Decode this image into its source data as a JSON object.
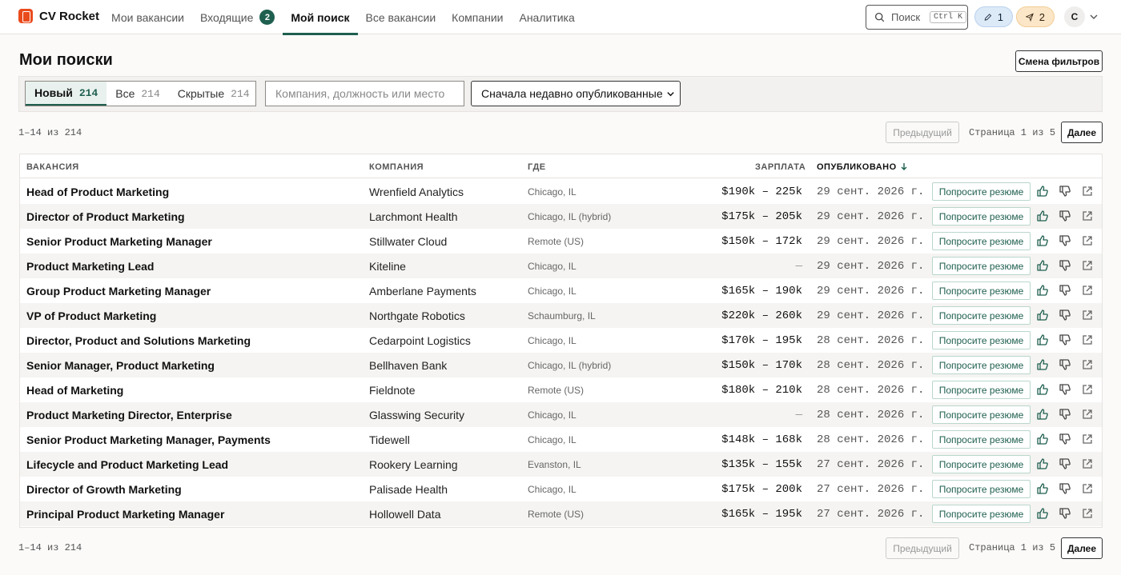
{
  "brand": {
    "name": "CV Rocket"
  },
  "nav": [
    {
      "label": "Мои вакансии"
    },
    {
      "label": "Входящие",
      "badge": "2"
    },
    {
      "label": "Мой поиск",
      "active": true
    },
    {
      "label": "Все вакансии"
    },
    {
      "label": "Компании"
    },
    {
      "label": "Аналитика"
    }
  ],
  "header": {
    "search_label": "Поиск",
    "search_shortcut": "Ctrl K",
    "edits_count": "1",
    "sent_count": "2",
    "avatar_initial": "C"
  },
  "page": {
    "title": "Мои поиски",
    "change_filters_label": "Смена фильтров"
  },
  "filters": {
    "tabs": [
      {
        "label": "Новый",
        "count": "214",
        "active": true
      },
      {
        "label": "Все",
        "count": "214"
      },
      {
        "label": "Скрытые",
        "count": "214"
      }
    ],
    "search_placeholder": "Компания, должность или место",
    "sort_value": "Сначала недавно опубликованные"
  },
  "pagination": {
    "range_label": "1–14 из 214",
    "prev_label": "Предыдущий",
    "page_label": "Страница 1 из 5",
    "next_label": "Далее"
  },
  "table": {
    "columns": {
      "title": "ВАКАНСИЯ",
      "company": "КОМПАНИЯ",
      "location": "ГДЕ",
      "salary": "ЗАРПЛАТА",
      "published": "ОПУБЛИКОВАНО"
    },
    "resume_label": "Попросите резюме",
    "rows": [
      {
        "title": "Head of Product Marketing",
        "company": "Wrenfield Analytics",
        "location": "Chicago, IL",
        "salary": "$190k – 225k",
        "date": "29 сент. 2026 г."
      },
      {
        "title": "Director of Product Marketing",
        "company": "Larchmont Health",
        "location": "Chicago, IL (hybrid)",
        "salary": "$175k – 205k",
        "date": "29 сент. 2026 г."
      },
      {
        "title": "Senior Product Marketing Manager",
        "company": "Stillwater Cloud",
        "location": "Remote (US)",
        "salary": "$150k – 172k",
        "date": "29 сент. 2026 г."
      },
      {
        "title": "Product Marketing Lead",
        "company": "Kiteline",
        "location": "Chicago, IL",
        "salary": "—",
        "date": "29 сент. 2026 г."
      },
      {
        "title": "Group Product Marketing Manager",
        "company": "Amberlane Payments",
        "location": "Chicago, IL",
        "salary": "$165k – 190k",
        "date": "29 сент. 2026 г."
      },
      {
        "title": "VP of Product Marketing",
        "company": "Northgate Robotics",
        "location": "Schaumburg, IL",
        "salary": "$220k – 260k",
        "date": "29 сент. 2026 г."
      },
      {
        "title": "Director, Product and Solutions Marketing",
        "company": "Cedarpoint Logistics",
        "location": "Chicago, IL",
        "salary": "$170k – 195k",
        "date": "28 сент. 2026 г."
      },
      {
        "title": "Senior Manager, Product Marketing",
        "company": "Bellhaven Bank",
        "location": "Chicago, IL (hybrid)",
        "salary": "$150k – 170k",
        "date": "28 сент. 2026 г."
      },
      {
        "title": "Head of Marketing",
        "company": "Fieldnote",
        "location": "Remote (US)",
        "salary": "$180k – 210k",
        "date": "28 сент. 2026 г."
      },
      {
        "title": "Product Marketing Director, Enterprise",
        "company": "Glasswing Security",
        "location": "Chicago, IL",
        "salary": "—",
        "date": "28 сент. 2026 г."
      },
      {
        "title": "Senior Product Marketing Manager, Payments",
        "company": "Tidewell",
        "location": "Chicago, IL",
        "salary": "$148k – 168k",
        "date": "28 сент. 2026 г."
      },
      {
        "title": "Lifecycle and Product Marketing Lead",
        "company": "Rookery Learning",
        "location": "Evanston, IL",
        "salary": "$135k – 155k",
        "date": "27 сент. 2026 г."
      },
      {
        "title": "Director of Growth Marketing",
        "company": "Palisade Health",
        "location": "Chicago, IL",
        "salary": "$175k – 200k",
        "date": "27 сент. 2026 г."
      },
      {
        "title": "Principal Product Marketing Manager",
        "company": "Hollowell Data",
        "location": "Remote (US)",
        "salary": "$165k – 195k",
        "date": "27 сент. 2026 г."
      }
    ]
  },
  "colors": {
    "accent": "#1f5f4f",
    "brand": "#ea4b1d"
  }
}
